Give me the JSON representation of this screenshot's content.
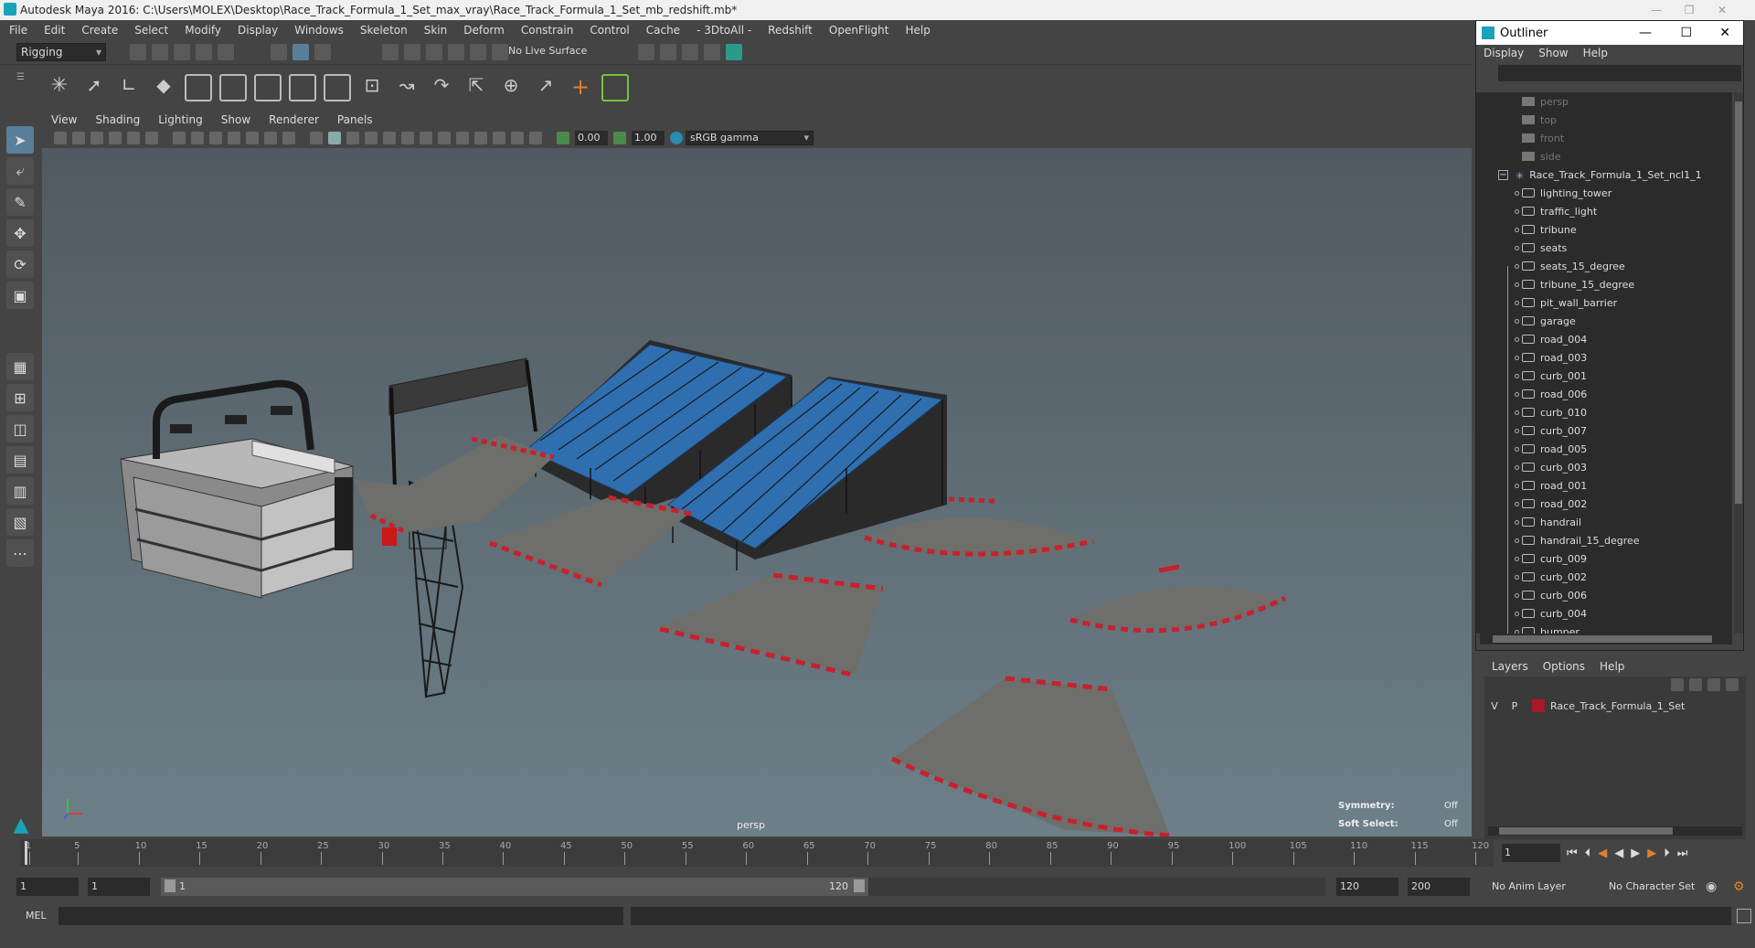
{
  "window": {
    "title": "Autodesk Maya 2016: C:\\Users\\MOLEX\\Desktop\\Race_Track_Formula_1_Set_max_vray\\Race_Track_Formula_1_Set_mb_redshift.mb*"
  },
  "menubar": [
    "File",
    "Edit",
    "Create",
    "Select",
    "Modify",
    "Display",
    "Windows",
    "Skeleton",
    "Skin",
    "Deform",
    "Constrain",
    "Control",
    "Cache",
    "- 3DtoAll -",
    "Redshift",
    "OpenFlight",
    "Help"
  ],
  "statusline": {
    "menuset": "Rigging",
    "live_surface": "No Live Surface"
  },
  "viewport": {
    "menus": [
      "View",
      "Shading",
      "Lighting",
      "Show",
      "Renderer",
      "Panels"
    ],
    "near_value": "0.00",
    "far_value": "1.00",
    "color_space": "sRGB gamma",
    "camera_label": "persp",
    "symmetry_label": "Symmetry:",
    "symmetry_value": "Off",
    "soft_select_label": "Soft Select:",
    "soft_select_value": "Off"
  },
  "outliner": {
    "title": "Outliner",
    "menus": [
      "Display",
      "Show",
      "Help"
    ],
    "cameras": [
      "persp",
      "top",
      "front",
      "side"
    ],
    "group": "Race_Track_Formula_1_Set_ncl1_1",
    "children": [
      "lighting_tower",
      "traffic_light",
      "tribune",
      "seats",
      "seats_15_degree",
      "tribune_15_degree",
      "pit_wall_barrier",
      "garage",
      "road_004",
      "road_003",
      "curb_001",
      "road_006",
      "curb_010",
      "curb_007",
      "road_005",
      "curb_003",
      "road_001",
      "road_002",
      "handrail",
      "handrail_15_degree",
      "curb_009",
      "curb_002",
      "curb_006",
      "curb_004",
      "bumper"
    ]
  },
  "layers": {
    "menus": [
      "Layers",
      "Options",
      "Help"
    ],
    "row": {
      "v": "V",
      "p": "P",
      "name": "Race_Track_Formula_1_Set",
      "color": "#a81828"
    }
  },
  "timeslider": {
    "ticks": [
      "1",
      "5",
      "10",
      "15",
      "20",
      "25",
      "30",
      "35",
      "40",
      "45",
      "50",
      "55",
      "60",
      "65",
      "70",
      "75",
      "80",
      "85",
      "90",
      "95",
      "100",
      "105",
      "110",
      "115",
      "120"
    ],
    "current_frame": "1"
  },
  "rangeslider": {
    "start": "1",
    "anim_start": "1",
    "range_start": "1",
    "range_end": "120",
    "anim_end": "120",
    "end": "200",
    "anim_layer": "No Anim Layer",
    "char_set": "No Character Set"
  },
  "cmdline": {
    "label": "MEL"
  },
  "colors": {
    "accent": "#1aa3b8",
    "curb_red": "#c8202c",
    "seat_blue": "#2f6fb0"
  }
}
